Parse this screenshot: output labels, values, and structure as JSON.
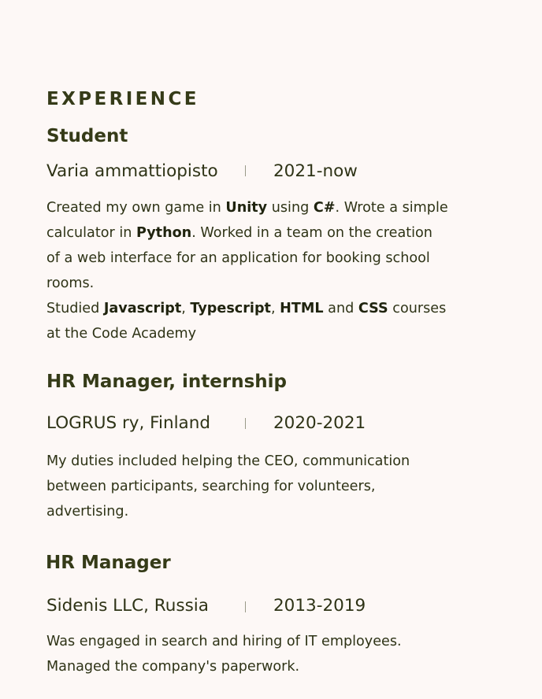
{
  "section": {
    "title": "EXPERIENCE"
  },
  "jobs": [
    {
      "title": "Student",
      "company": "Varia ammattiopisto",
      "period": "2021-now",
      "description": [
        {
          "t": "Created my own game in "
        },
        {
          "t": "Unity",
          "b": true
        },
        {
          "t": " using "
        },
        {
          "t": "C#",
          "b": true
        },
        {
          "t": ". Wrote a simple calculator in "
        },
        {
          "t": "Python",
          "b": true
        },
        {
          "t": ". Worked in a team on the creation of a web interface for an application for booking school rooms."
        },
        {
          "br": true
        },
        {
          "t": "Studied "
        },
        {
          "t": "Javascript",
          "b": true
        },
        {
          "t": ", "
        },
        {
          "t": "Typescript",
          "b": true
        },
        {
          "t": ", "
        },
        {
          "t": "HTML",
          "b": true
        },
        {
          "t": " and "
        },
        {
          "t": "CSS",
          "b": true
        },
        {
          "t": " courses at the Code Academy"
        }
      ]
    },
    {
      "title": "HR Manager, internship",
      "company": "LOGRUS ry, Finland",
      "period": "2020-2021",
      "description": [
        {
          "t": "My duties included helping the CEO, communication between participants, searching for volunteers, advertising."
        }
      ]
    },
    {
      "title": "HR Manager",
      "company": "Sidenis LLC, Russia",
      "period": "2013-2019",
      "description": [
        {
          "t": "Was engaged in search and hiring of IT employees. Managed the company's paperwork."
        }
      ]
    }
  ]
}
